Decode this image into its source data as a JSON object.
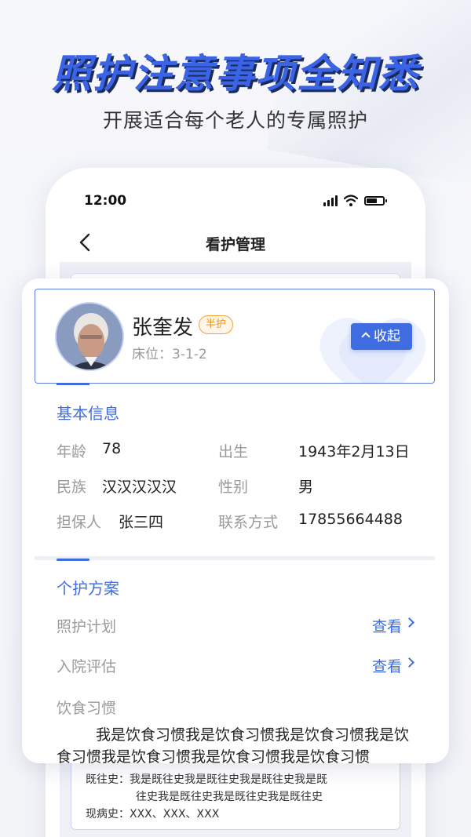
{
  "promo": {
    "title": "照护注意事项全知悉",
    "subtitle": "开展适合每个老人的专属照护"
  },
  "status_bar": {
    "time": "12:00"
  },
  "nav": {
    "title": "看护管理"
  },
  "resident": {
    "name": "张奎发",
    "care_tag": "半护",
    "bed": "床位：3-1-2",
    "collapse_label": "收起"
  },
  "basic_info": {
    "title": "基本信息",
    "age_label": "年龄",
    "age_value": "78",
    "birth_label": "出生",
    "birth_value": "1943年2月13日",
    "ethnic_label": "民族",
    "ethnic_value": "汉汉汉汉汉",
    "gender_label": "性别",
    "gender_value": "男",
    "guarantor_label": "担保人",
    "guarantor_value": "张三四",
    "contact_label": "联系方式",
    "contact_value": "17855664488"
  },
  "care_plan": {
    "title": "个护方案",
    "plan_label": "照护计划",
    "plan_link": "查看",
    "assessment_label": "入院评估",
    "assessment_link": "查看",
    "diet_label": "饮食习惯",
    "diet_text": "我是饮食习惯我是饮食习惯我是饮食习惯我是饮食习惯我是饮食习惯我是饮食习惯我是饮食习惯"
  },
  "background_card": {
    "history_line1": "既往史：我是既往史我是既往史我是既往史我是既",
    "history_line2": "往史我是既往史我是既往史我是既往史",
    "current_illness": "现病史：XXX、XXX、XXX"
  },
  "colors": {
    "accent": "#3f6ce0",
    "tag": "#ef9320",
    "label": "#9a9a9a"
  }
}
